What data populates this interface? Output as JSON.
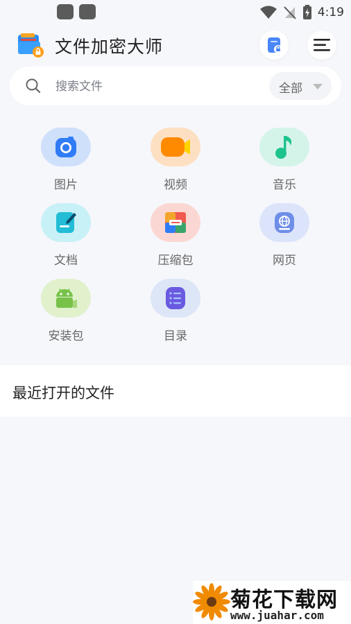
{
  "status_bar": {
    "time": "4:19"
  },
  "header": {
    "title": "文件加密大师"
  },
  "search": {
    "placeholder": "搜索文件",
    "filter_label": "全部"
  },
  "categories": [
    {
      "label": "图片",
      "icon": "camera-icon",
      "bg": "#cfe0fb",
      "fg": "#2f7cf6"
    },
    {
      "label": "视频",
      "icon": "video-icon",
      "bg": "#fde0c2",
      "fg": "#ff8a00"
    },
    {
      "label": "音乐",
      "icon": "music-icon",
      "bg": "#d4f4ea",
      "fg": "#1ec38e"
    },
    {
      "label": "文档",
      "icon": "document-icon",
      "bg": "#c7f1f7",
      "fg": "#22bcd6"
    },
    {
      "label": "压缩包",
      "icon": "archive-icon",
      "bg": "#fbd7d3",
      "fg": "#f05a4f"
    },
    {
      "label": "网页",
      "icon": "web-icon",
      "bg": "#dce4fb",
      "fg": "#6e8ee8"
    },
    {
      "label": "安装包",
      "icon": "android-icon",
      "bg": "#e0f1cc",
      "fg": "#78c24a"
    },
    {
      "label": "目录",
      "icon": "list-icon",
      "bg": "#dde6f6",
      "fg": "#6a5ae0"
    }
  ],
  "recent": {
    "title": "最近打开的文件"
  },
  "watermark": {
    "text": "菊花下载网",
    "url": "www.juahar.com"
  }
}
